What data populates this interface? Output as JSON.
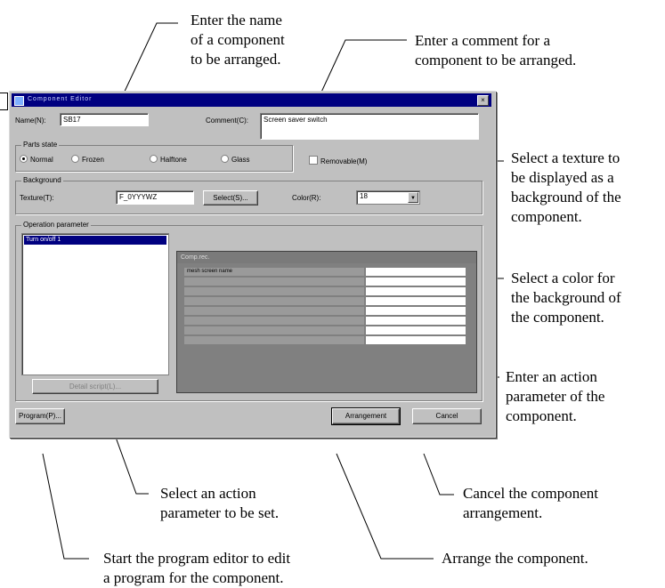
{
  "callouts": {
    "name": "Enter the name\nof a component\nto be arranged.",
    "comment": "Enter a comment for a\ncomponent to be arranged.",
    "texture": "Select a texture to\nbe displayed as a\nbackground of the\ncomponent.",
    "color": "Select a color for\nthe background of\nthe component.",
    "action_param": "Enter an action\nparameter of the\ncomponent.",
    "select_param": "Select an action\nparameter to be set.",
    "cancel": "Cancel the component\narrangement.",
    "arrange": "Arrange the component.",
    "program": "Start the program editor to edit\na program for the component."
  },
  "dialog": {
    "title": "Component Editor",
    "close": "×",
    "name_label": "Name(N):",
    "name_value": "SB17",
    "comment_label": "Comment(C):",
    "comment_value": "Screen saver switch",
    "parts_state": {
      "title": "Parts state",
      "options": [
        "Normal",
        "Frozen",
        "Halftone",
        "Glass"
      ],
      "selected": "Normal"
    },
    "removable_label": "Removable(M)",
    "background": {
      "title": "Background",
      "texture_label": "Texture(T):",
      "texture_value": "F_0YYYWZ",
      "select_button": "Select(S)...",
      "color_label": "Color(R):",
      "color_value": "18"
    },
    "operation": {
      "title": "Operation parameter",
      "list_selected": "Turn on/off 1",
      "table_header": "Comp.rec.",
      "table_rows": [
        "mesh screen name",
        "",
        "",
        "",
        "",
        "",
        "",
        ""
      ],
      "detail_button": "Detail script(L)..."
    },
    "program_button": "Program(P)...",
    "arrangement_button": "Arrangement",
    "cancel_button": "Cancel"
  }
}
